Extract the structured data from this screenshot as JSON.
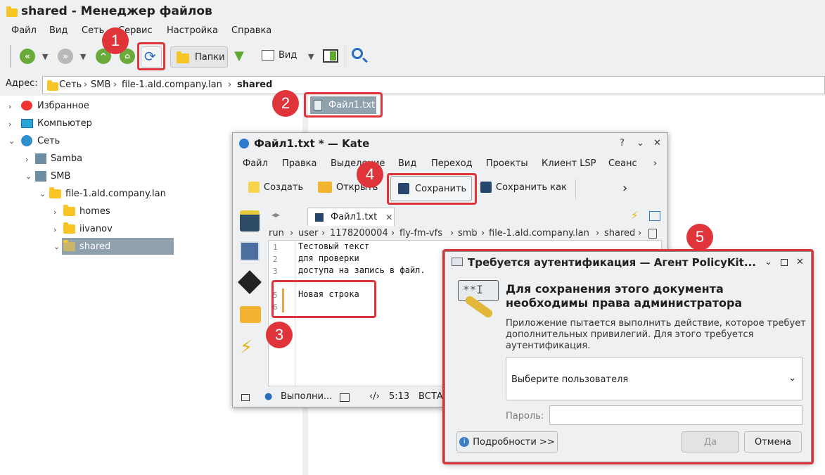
{
  "file_manager": {
    "title": "shared - Менеджер файлов",
    "menu": [
      "Файл",
      "Вид",
      "Сеть",
      "Сервис",
      "Настройка",
      "Справка"
    ],
    "toolbar": {
      "folders_label": "Папки",
      "view_label": "Вид"
    },
    "address": {
      "label": "Адрес:",
      "segments": [
        "Сеть",
        "SMB",
        "file-1.ald.company.lan",
        "shared"
      ]
    },
    "tree": [
      {
        "label": "Избранное"
      },
      {
        "label": "Компьютер"
      },
      {
        "label": "Сеть"
      },
      {
        "label": "Samba"
      },
      {
        "label": "SMB"
      },
      {
        "label": "file-1.ald.company.lan"
      },
      {
        "label": "homes"
      },
      {
        "label": "iivanov"
      },
      {
        "label": "shared"
      }
    ],
    "files": [
      {
        "name": "Файл1.txt"
      }
    ]
  },
  "kate": {
    "title": "Файл1.txt * — Kate",
    "menu": [
      "Файл",
      "Правка",
      "Выделение",
      "Вид",
      "Переход",
      "Проекты",
      "Клиент LSP",
      "Сеанс"
    ],
    "toolbar": {
      "new": "Создать",
      "open": "Открыть",
      "save": "Сохранить",
      "save_as": "Сохранить как"
    },
    "tab": {
      "label": "Файл1.txt"
    },
    "breadcrumb": [
      "run",
      "user",
      "1178200004",
      "fly-fm-vfs",
      "smb",
      "file-1.ald.company.lan",
      "shared"
    ],
    "editor": {
      "line_numbers": [
        "1",
        "2",
        "3",
        "5",
        "6"
      ],
      "lines": [
        "Тестовый текст",
        "для проверки",
        "доступа на запись в файл.",
        "Новая строка"
      ]
    },
    "status": {
      "search": "Выполни...",
      "position": "5:13",
      "mode": "ВСТА"
    }
  },
  "auth_dialog": {
    "title": "Требуется аутентификация — Агент PolicyKit...",
    "heading": "Для сохранения этого документа необходимы права администратора",
    "description": "Приложение пытается выполнить действие, которое требует дополнительных привилегий. Для этого требуется аутентификация.",
    "user_select": "Выберите пользователя",
    "password_label": "Пароль:",
    "details_button": "Подробности >>",
    "ok_button": "Да",
    "cancel_button": "Отмена"
  },
  "markers": [
    "1",
    "2",
    "3",
    "4",
    "5"
  ],
  "colors": {
    "highlight": "#e0343b",
    "selection": "#8fa1ad"
  }
}
